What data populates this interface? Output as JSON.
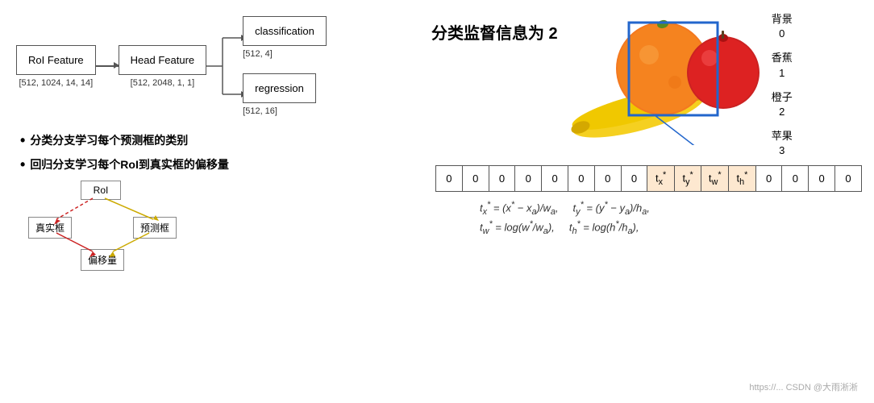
{
  "flow": {
    "roi_label": "RoI Feature",
    "roi_shape": "[512, 1024, 14, 14]",
    "head_label": "Head Feature",
    "head_shape": "[512, 2048, 1, 1]",
    "classification_label": "classification",
    "classification_shape": "[512, 4]",
    "regression_label": "regression",
    "regression_shape": "[512, 16]"
  },
  "bullets": {
    "b1": "分类分支学习每个预测框的类别",
    "b2": "回归分支学习每个RoI到真实框的偏移量"
  },
  "small_diagram": {
    "roi_label": "RoI",
    "truth_label": "真实框",
    "pred_label": "预测框",
    "offset_label": "偏移量"
  },
  "right": {
    "class_info": "分类监督信息为 2",
    "legend": [
      {
        "name": "背景",
        "num": "0"
      },
      {
        "name": "香蕉",
        "num": "1"
      },
      {
        "name": "橙子",
        "num": "2"
      },
      {
        "name": "苹果",
        "num": "3"
      }
    ],
    "one_hot": [
      "0",
      "0",
      "0",
      "0",
      "0",
      "0",
      "0",
      "0",
      "tx*",
      "ty*",
      "tw*",
      "th*",
      "0",
      "0",
      "0",
      "0"
    ],
    "formulas": [
      "t*x = (x* − xa)/wa,    t*y = (y* − ya)/ha,",
      "t*w = log(w*/wa),    t*h = log(h*/ha),"
    ]
  },
  "watermark": "https://... CSDN @大雨淅淅"
}
